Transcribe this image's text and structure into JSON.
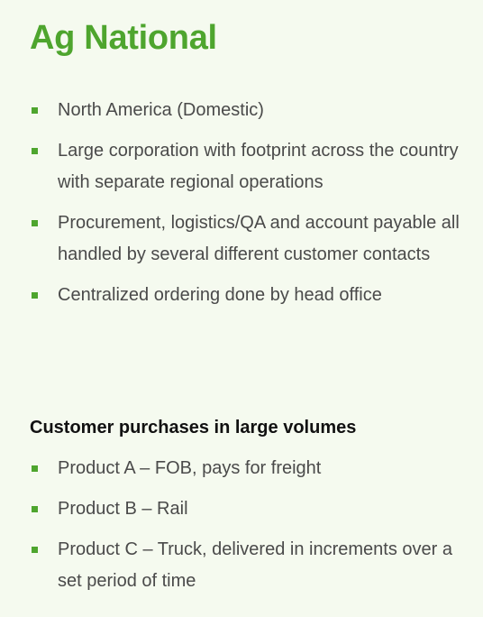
{
  "title": "Ag National",
  "profile_bullets": [
    "North America (Domestic)",
    "Large corporation with footprint across the country with separate regional operations",
    "Procurement, logistics/QA and account payable all handled by several different customer contacts",
    "Centralized ordering done by head office"
  ],
  "purchases_heading": "Customer purchases in large volumes",
  "purchase_bullets": [
    "Product A – FOB, pays for freight",
    "Product B – Rail",
    "Product C – Truck, delivered in increments over a set period of time"
  ],
  "colors": {
    "accent": "#4ea52e",
    "background": "#f5faef",
    "body_text": "#4a4a4a",
    "heading_text": "#111111"
  }
}
